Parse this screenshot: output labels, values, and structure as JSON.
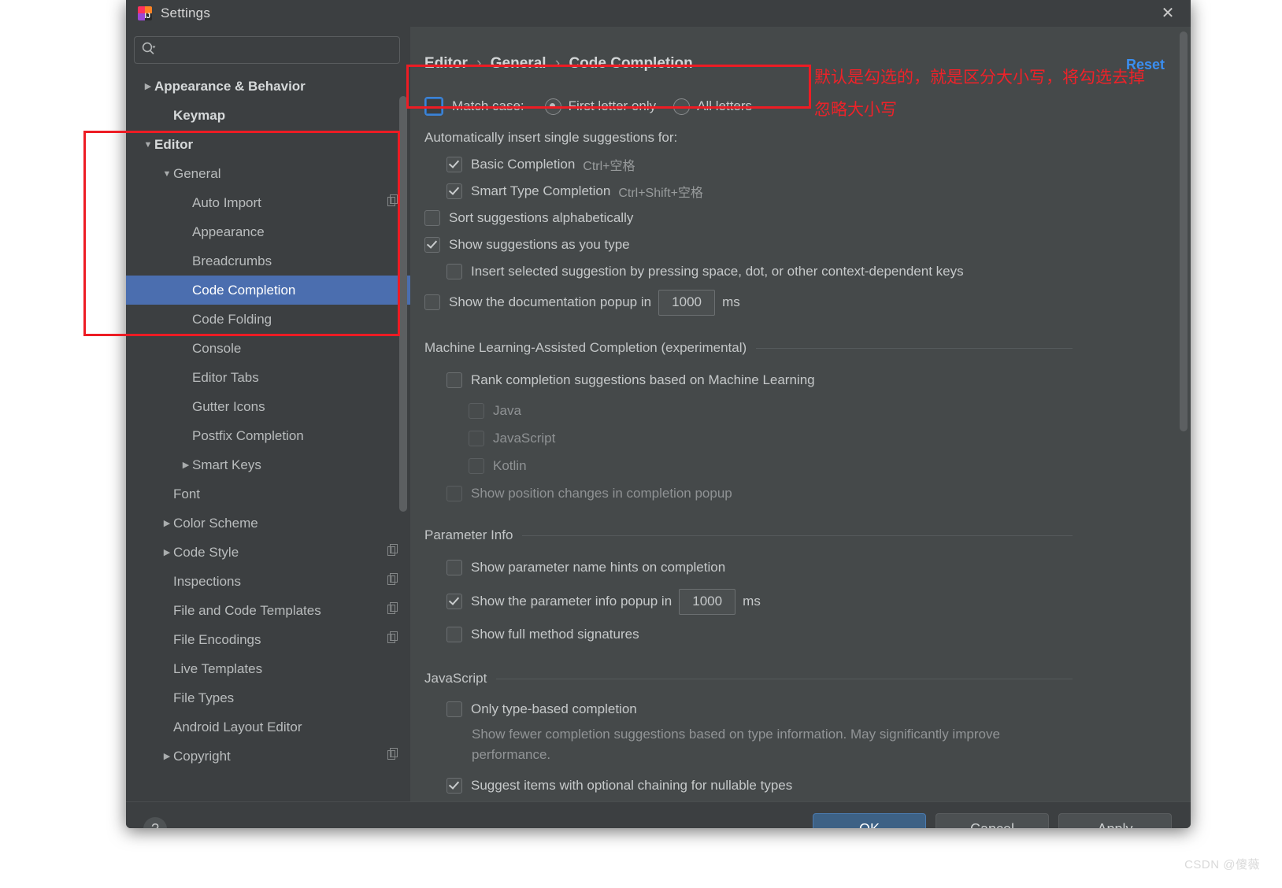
{
  "window": {
    "title": "Settings",
    "close_label": "✕",
    "app_icon_letters": "IJ"
  },
  "sidebar": {
    "search": {
      "value": "",
      "placeholder": ""
    },
    "items": [
      {
        "label": "Appearance & Behavior",
        "arrow": "▶",
        "indent": 0,
        "bold": true,
        "selected": false,
        "copy": false
      },
      {
        "label": "Keymap",
        "arrow": "",
        "indent": 1,
        "bold": true,
        "selected": false,
        "copy": false
      },
      {
        "label": "Editor",
        "arrow": "▼",
        "indent": 0,
        "bold": true,
        "selected": false,
        "copy": false
      },
      {
        "label": "General",
        "arrow": "▼",
        "indent": 1,
        "bold": false,
        "selected": false,
        "copy": false
      },
      {
        "label": "Auto Import",
        "arrow": "",
        "indent": 2,
        "bold": false,
        "selected": false,
        "copy": true
      },
      {
        "label": "Appearance",
        "arrow": "",
        "indent": 2,
        "bold": false,
        "selected": false,
        "copy": false
      },
      {
        "label": "Breadcrumbs",
        "arrow": "",
        "indent": 2,
        "bold": false,
        "selected": false,
        "copy": false
      },
      {
        "label": "Code Completion",
        "arrow": "",
        "indent": 2,
        "bold": false,
        "selected": true,
        "copy": false
      },
      {
        "label": "Code Folding",
        "arrow": "",
        "indent": 2,
        "bold": false,
        "selected": false,
        "copy": false
      },
      {
        "label": "Console",
        "arrow": "",
        "indent": 2,
        "bold": false,
        "selected": false,
        "copy": false
      },
      {
        "label": "Editor Tabs",
        "arrow": "",
        "indent": 2,
        "bold": false,
        "selected": false,
        "copy": false
      },
      {
        "label": "Gutter Icons",
        "arrow": "",
        "indent": 2,
        "bold": false,
        "selected": false,
        "copy": false
      },
      {
        "label": "Postfix Completion",
        "arrow": "",
        "indent": 2,
        "bold": false,
        "selected": false,
        "copy": false
      },
      {
        "label": "Smart Keys",
        "arrow": "▶",
        "indent": 2,
        "bold": false,
        "selected": false,
        "copy": false
      },
      {
        "label": "Font",
        "arrow": "",
        "indent": 1,
        "bold": false,
        "selected": false,
        "copy": false
      },
      {
        "label": "Color Scheme",
        "arrow": "▶",
        "indent": 1,
        "bold": false,
        "selected": false,
        "copy": false
      },
      {
        "label": "Code Style",
        "arrow": "▶",
        "indent": 1,
        "bold": false,
        "selected": false,
        "copy": true
      },
      {
        "label": "Inspections",
        "arrow": "",
        "indent": 1,
        "bold": false,
        "selected": false,
        "copy": true
      },
      {
        "label": "File and Code Templates",
        "arrow": "",
        "indent": 1,
        "bold": false,
        "selected": false,
        "copy": true
      },
      {
        "label": "File Encodings",
        "arrow": "",
        "indent": 1,
        "bold": false,
        "selected": false,
        "copy": true
      },
      {
        "label": "Live Templates",
        "arrow": "",
        "indent": 1,
        "bold": false,
        "selected": false,
        "copy": false
      },
      {
        "label": "File Types",
        "arrow": "",
        "indent": 1,
        "bold": false,
        "selected": false,
        "copy": false
      },
      {
        "label": "Android Layout Editor",
        "arrow": "",
        "indent": 1,
        "bold": false,
        "selected": false,
        "copy": false
      },
      {
        "label": "Copyright",
        "arrow": "▶",
        "indent": 1,
        "bold": false,
        "selected": false,
        "copy": true
      }
    ]
  },
  "main": {
    "breadcrumb": {
      "part1": "Editor",
      "sep": "›",
      "part2": "General",
      "part3": "Code Completion"
    },
    "reset_label": "Reset",
    "match_case": {
      "label": "Match case:",
      "checked": false,
      "options": [
        {
          "label": "First letter only",
          "selected": true
        },
        {
          "label": "All letters",
          "selected": false
        }
      ]
    },
    "auto_insert_header": "Automatically insert single suggestions for:",
    "auto_insert_items": [
      {
        "label": "Basic Completion",
        "shortcut": "Ctrl+空格",
        "checked": true
      },
      {
        "label": "Smart Type Completion",
        "shortcut": "Ctrl+Shift+空格",
        "checked": true
      }
    ],
    "general_items": [
      {
        "label": "Sort suggestions alphabetically",
        "checked": false,
        "indent": 0
      },
      {
        "label": "Show suggestions as you type",
        "checked": true,
        "indent": 0
      },
      {
        "label": "Insert selected suggestion by pressing space, dot, or other context-dependent keys",
        "checked": false,
        "indent": 1
      }
    ],
    "doc_popup": {
      "label": "Show the documentation popup in",
      "checked": false,
      "value": "1000",
      "unit": "ms"
    },
    "ml_section": {
      "title": "Machine Learning-Assisted Completion (experimental)",
      "rank_label": "Rank completion suggestions based on Machine Learning",
      "rank_checked": false,
      "languages": [
        {
          "label": "Java",
          "checked": false
        },
        {
          "label": "JavaScript",
          "checked": false
        },
        {
          "label": "Kotlin",
          "checked": false
        }
      ],
      "position_label": "Show position changes in completion popup",
      "position_checked": false
    },
    "parameter_section": {
      "title": "Parameter Info",
      "hints_label": "Show parameter name hints on completion",
      "hints_checked": false,
      "popup_label": "Show the parameter info popup in",
      "popup_checked": true,
      "popup_value": "1000",
      "popup_unit": "ms",
      "signatures_label": "Show full method signatures",
      "signatures_checked": false
    },
    "javascript_section": {
      "title": "JavaScript",
      "only_type_label": "Only type-based completion",
      "only_type_checked": false,
      "only_type_desc": "Show fewer completion suggestions based on type information. May significantly improve performance.",
      "optional_chaining_label": "Suggest items with optional chaining for nullable types",
      "optional_chaining_checked": true
    }
  },
  "footer": {
    "help_label": "?",
    "ok_label": "OK",
    "cancel_label": "Cancel",
    "apply_label": "Apply"
  },
  "annotations": {
    "line1": "默认是勾选的，就是区分大小写，将勾选去掉",
    "line2": "忽略大小写",
    "color": "#ee2229"
  },
  "watermark": "CSDN @傻薇"
}
